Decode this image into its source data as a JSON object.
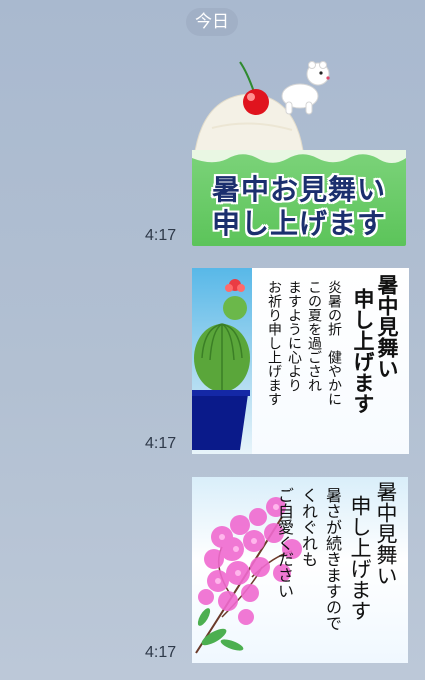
{
  "date_label": "今日",
  "messages": [
    {
      "time": "4:17",
      "sticker": {
        "lines": [
          "暑中お見舞い",
          "申し上げます"
        ],
        "icons": [
          "cherry-icon",
          "polar-bear-icon",
          "shaved-ice-icon"
        ]
      }
    },
    {
      "time": "4:17",
      "sticker": {
        "heading": [
          "暑中見舞い",
          "申し上げます"
        ],
        "body": [
          "炎暑の折　健やかに",
          "この夏を過ごされ",
          "ますように心より",
          "お祈り申し上げます"
        ],
        "icons": [
          "cactus-icon",
          "flower-pot-icon"
        ]
      }
    },
    {
      "time": "4:17",
      "sticker": {
        "heading": [
          "暑中見舞い",
          "申し上げます"
        ],
        "body": [
          "暑さが続きますので",
          "くれぐれも",
          "ご自愛ください"
        ],
        "icons": [
          "pink-flowers-icon"
        ]
      }
    }
  ],
  "colors": {
    "background": "#b2c0d2",
    "banner_green": "#5cc45a",
    "heading_navy": "#1b2f6e",
    "pot_blue": "#0a1a8a",
    "flower_pink": "#f06ad0"
  }
}
